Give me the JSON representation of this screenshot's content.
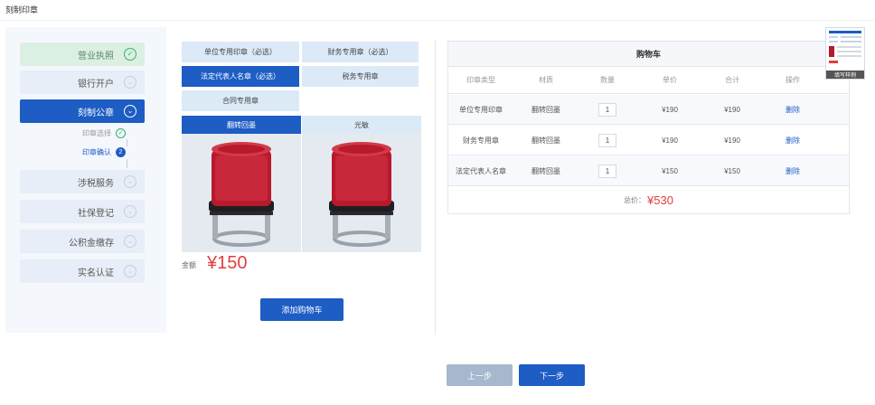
{
  "page": {
    "title": "刻制印章"
  },
  "sidebar": {
    "items": [
      {
        "label": "营业执照",
        "state": "done"
      },
      {
        "label": "银行开户",
        "state": "pending"
      },
      {
        "label": "刻制公章",
        "state": "active"
      },
      {
        "label": "涉税服务",
        "state": "pending"
      },
      {
        "label": "社保登记",
        "state": "pending"
      },
      {
        "label": "公积金缴存",
        "state": "pending"
      },
      {
        "label": "实名认证",
        "state": "pending"
      }
    ],
    "substeps": [
      {
        "label": "印章选择",
        "state": "done"
      },
      {
        "label": "印章确认",
        "state": "current",
        "number": "2"
      }
    ]
  },
  "seal_types": [
    {
      "label": "单位专用印章（必选）",
      "selected": false
    },
    {
      "label": "财务专用章（必选）",
      "selected": false
    },
    {
      "label": "法定代表人名章（必选）",
      "selected": true
    },
    {
      "label": "税务专用章",
      "selected": false
    },
    {
      "label": "合同专用章",
      "selected": false
    }
  ],
  "materials": [
    {
      "label": "翻转回墨",
      "selected": true
    },
    {
      "label": "光敏",
      "selected": false
    }
  ],
  "amount": {
    "label": "金额",
    "value": "¥150"
  },
  "add_to_cart_label": "添加购物车",
  "cart": {
    "title": "购物车",
    "columns": [
      "印章类型",
      "材质",
      "数量",
      "单价",
      "合计",
      "操作"
    ],
    "rows": [
      {
        "type": "单位专用印章",
        "material": "翻转回墨",
        "qty": "1",
        "unit_price": "¥190",
        "total": "¥190",
        "action": "删除"
      },
      {
        "type": "财务专用章",
        "material": "翻转回墨",
        "qty": "1",
        "unit_price": "¥190",
        "total": "¥190",
        "action": "删除"
      },
      {
        "type": "法定代表人名章",
        "material": "翻转回墨",
        "qty": "1",
        "unit_price": "¥150",
        "total": "¥150",
        "action": "删除"
      }
    ],
    "total_label": "总价：",
    "total_value": "¥530"
  },
  "nav": {
    "prev_label": "上一步",
    "next_label": "下一步"
  },
  "sample": {
    "label": "填写样例"
  },
  "colors": {
    "primary": "#1d5dc4",
    "price": "#e63c3c",
    "done": "#34b36a",
    "light_tab": "#dceaf8",
    "disabled_button": "#a7b7cd"
  }
}
